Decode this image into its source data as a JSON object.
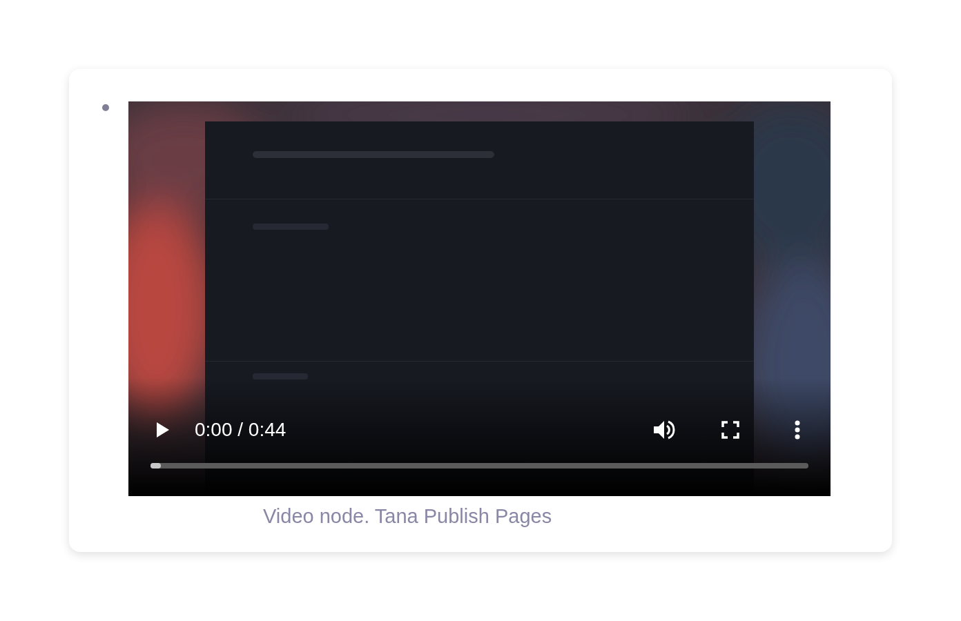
{
  "video": {
    "kind": "picture",
    "time": "0:00 / 0:44",
    "progress": {
      "level": 0.016
    }
  },
  "caption": "Video node. Tana Publish Pages"
}
